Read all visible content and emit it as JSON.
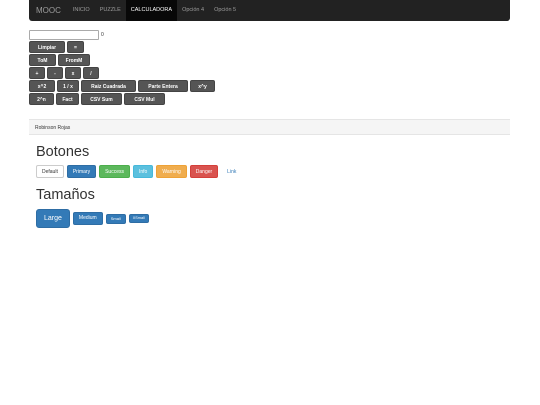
{
  "navbar": {
    "brand": "MOOC",
    "items": [
      {
        "label": "INICIO",
        "active": false
      },
      {
        "label": "PUZZLE",
        "active": false
      },
      {
        "label": "CALCULADORA",
        "active": true
      },
      {
        "label": "Opción 4",
        "active": false
      },
      {
        "label": "Opción 5",
        "active": false
      }
    ]
  },
  "calculator": {
    "display_value": "",
    "result": "0",
    "rows": [
      [
        "Limpiar",
        "="
      ],
      [
        "ToM",
        "FromM"
      ],
      [
        "+",
        "-",
        "x",
        "/"
      ],
      [
        "x^2",
        "1 / x",
        "Raiz Cuadrada",
        "Parte Entera",
        "x^y"
      ],
      [
        "2^n",
        "Fact",
        "CSV Sum",
        "CSV Mul"
      ]
    ]
  },
  "footer": {
    "author": "Robinson Rojas"
  },
  "botones": {
    "heading": "Botones",
    "buttons": [
      {
        "label": "Default",
        "style": "default"
      },
      {
        "label": "Primary",
        "style": "primary"
      },
      {
        "label": "Success",
        "style": "success"
      },
      {
        "label": "Info",
        "style": "info"
      },
      {
        "label": "Warning",
        "style": "warning"
      },
      {
        "label": "Danger",
        "style": "danger"
      },
      {
        "label": "Link",
        "style": "link"
      }
    ]
  },
  "tamanos": {
    "heading": "Tamaños",
    "buttons": [
      {
        "label": "Large",
        "size": "lg"
      },
      {
        "label": "Medium",
        "size": "md"
      },
      {
        "label": "Small",
        "size": "sm"
      },
      {
        "label": "XSmall",
        "size": "xs"
      }
    ]
  }
}
